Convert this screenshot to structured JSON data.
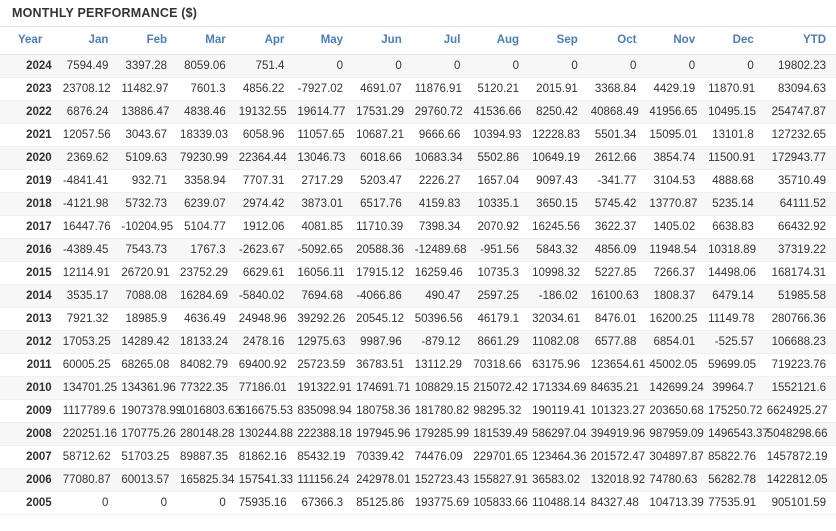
{
  "panel": {
    "title": "MONTHLY PERFORMANCE ($)"
  },
  "colors": {
    "header_text": "#4a7ebb",
    "negative": "#e8483f",
    "body_text": "#333333",
    "row_alt": "#f7f7f7"
  },
  "table": {
    "columns": [
      "Year",
      "Jan",
      "Feb",
      "Mar",
      "Apr",
      "May",
      "Jun",
      "Jul",
      "Aug",
      "Sep",
      "Oct",
      "Nov",
      "Dec",
      "YTD"
    ],
    "rows": [
      {
        "year": "2024",
        "values": [
          "7594.49",
          "3397.28",
          "8059.06",
          "751.4",
          "0",
          "0",
          "0",
          "0",
          "0",
          "0",
          "0",
          "0",
          "19802.23"
        ]
      },
      {
        "year": "2023",
        "values": [
          "23708.12",
          "11482.97",
          "7601.3",
          "4856.22",
          "-7927.02",
          "4691.07",
          "11876.91",
          "5120.21",
          "2015.91",
          "3368.84",
          "4429.19",
          "11870.91",
          "83094.63"
        ]
      },
      {
        "year": "2022",
        "values": [
          "6876.24",
          "13886.47",
          "4838.46",
          "19132.55",
          "19614.77",
          "17531.29",
          "29760.72",
          "41536.66",
          "8250.42",
          "40868.49",
          "41956.65",
          "10495.15",
          "254747.87"
        ]
      },
      {
        "year": "2021",
        "values": [
          "12057.56",
          "3043.67",
          "18339.03",
          "6058.96",
          "11057.65",
          "10687.21",
          "9666.66",
          "10394.93",
          "12228.83",
          "5501.34",
          "15095.01",
          "13101.8",
          "127232.65"
        ]
      },
      {
        "year": "2020",
        "values": [
          "2369.62",
          "5109.63",
          "79230.99",
          "22364.44",
          "13046.73",
          "6018.66",
          "10683.34",
          "5502.86",
          "10649.19",
          "2612.66",
          "3854.74",
          "11500.91",
          "172943.77"
        ]
      },
      {
        "year": "2019",
        "values": [
          "-4841.41",
          "932.71",
          "3358.94",
          "7707.31",
          "2717.29",
          "5203.47",
          "2226.27",
          "1657.04",
          "9097.43",
          "-341.77",
          "3104.53",
          "4888.68",
          "35710.49"
        ]
      },
      {
        "year": "2018",
        "values": [
          "-4121.98",
          "5732.73",
          "6239.07",
          "2974.42",
          "3873.01",
          "6517.76",
          "4159.83",
          "10335.1",
          "3650.15",
          "5745.42",
          "13770.87",
          "5235.14",
          "64111.52"
        ]
      },
      {
        "year": "2017",
        "values": [
          "16447.76",
          "-10204.95",
          "5104.77",
          "1912.06",
          "4081.85",
          "11710.39",
          "7398.34",
          "2070.92",
          "16245.56",
          "3622.37",
          "1405.02",
          "6638.83",
          "66432.92"
        ]
      },
      {
        "year": "2016",
        "values": [
          "-4389.45",
          "7543.73",
          "1767.3",
          "-2623.67",
          "-5092.65",
          "20588.36",
          "-12489.68",
          "-951.56",
          "5843.32",
          "4856.09",
          "11948.54",
          "10318.89",
          "37319.22"
        ]
      },
      {
        "year": "2015",
        "values": [
          "12114.91",
          "26720.91",
          "23752.29",
          "6629.61",
          "16056.11",
          "17915.12",
          "16259.46",
          "10735.3",
          "10998.32",
          "5227.85",
          "7266.37",
          "14498.06",
          "168174.31"
        ]
      },
      {
        "year": "2014",
        "values": [
          "3535.17",
          "7088.08",
          "16284.69",
          "-5840.02",
          "7694.68",
          "-4066.86",
          "490.47",
          "2597.25",
          "-186.02",
          "16100.63",
          "1808.37",
          "6479.14",
          "51985.58"
        ]
      },
      {
        "year": "2013",
        "values": [
          "7921.32",
          "18985.9",
          "4636.49",
          "24948.96",
          "39292.26",
          "20545.12",
          "50396.56",
          "46179.1",
          "32034.61",
          "8476.01",
          "16200.25",
          "11149.78",
          "280766.36"
        ]
      },
      {
        "year": "2012",
        "values": [
          "17053.25",
          "14289.42",
          "18133.24",
          "2478.16",
          "12975.63",
          "9987.96",
          "-879.12",
          "8661.29",
          "11082.08",
          "6577.88",
          "6854.01",
          "-525.57",
          "106688.23"
        ]
      },
      {
        "year": "2011",
        "values": [
          "60005.25",
          "68265.08",
          "84082.79",
          "69400.92",
          "25723.59",
          "36783.51",
          "13112.29",
          "70318.66",
          "63175.96",
          "123654.61",
          "45002.05",
          "59699.05",
          "719223.76"
        ]
      },
      {
        "year": "2010",
        "values": [
          "134701.25",
          "134361.96",
          "77322.35",
          "77186.01",
          "191322.91",
          "174691.71",
          "108829.15",
          "215072.42",
          "171334.69",
          "84635.21",
          "142699.24",
          "39964.7",
          "1552121.6"
        ]
      },
      {
        "year": "2009",
        "values": [
          "1117789.6",
          "1907378.99",
          "1016803.63",
          "616675.53",
          "835098.94",
          "180758.36",
          "181780.82",
          "98295.32",
          "190119.41",
          "101323.27",
          "203650.68",
          "175250.72",
          "6624925.27"
        ]
      },
      {
        "year": "2008",
        "values": [
          "220251.16",
          "170775.26",
          "280148.28",
          "130244.88",
          "222388.18",
          "197945.96",
          "179285.99",
          "181539.49",
          "586297.04",
          "394919.96",
          "987959.09",
          "1496543.37",
          "5048298.66"
        ]
      },
      {
        "year": "2007",
        "values": [
          "58712.62",
          "51703.25",
          "89887.35",
          "81862.16",
          "85432.19",
          "70339.42",
          "74476.09",
          "229701.65",
          "123464.36",
          "201572.47",
          "304897.87",
          "85822.76",
          "1457872.19"
        ]
      },
      {
        "year": "2006",
        "values": [
          "77080.87",
          "60013.57",
          "165825.34",
          "157541.33",
          "111156.24",
          "242978.01",
          "152723.43",
          "155827.91",
          "36583.02",
          "132018.92",
          "74780.63",
          "56282.78",
          "1422812.05"
        ]
      },
      {
        "year": "2005",
        "values": [
          "0",
          "0",
          "0",
          "75935.16",
          "67366.3",
          "85125.86",
          "193775.69",
          "105833.66",
          "110488.14",
          "84327.48",
          "104713.39",
          "77535.91",
          "905101.59"
        ]
      }
    ]
  }
}
